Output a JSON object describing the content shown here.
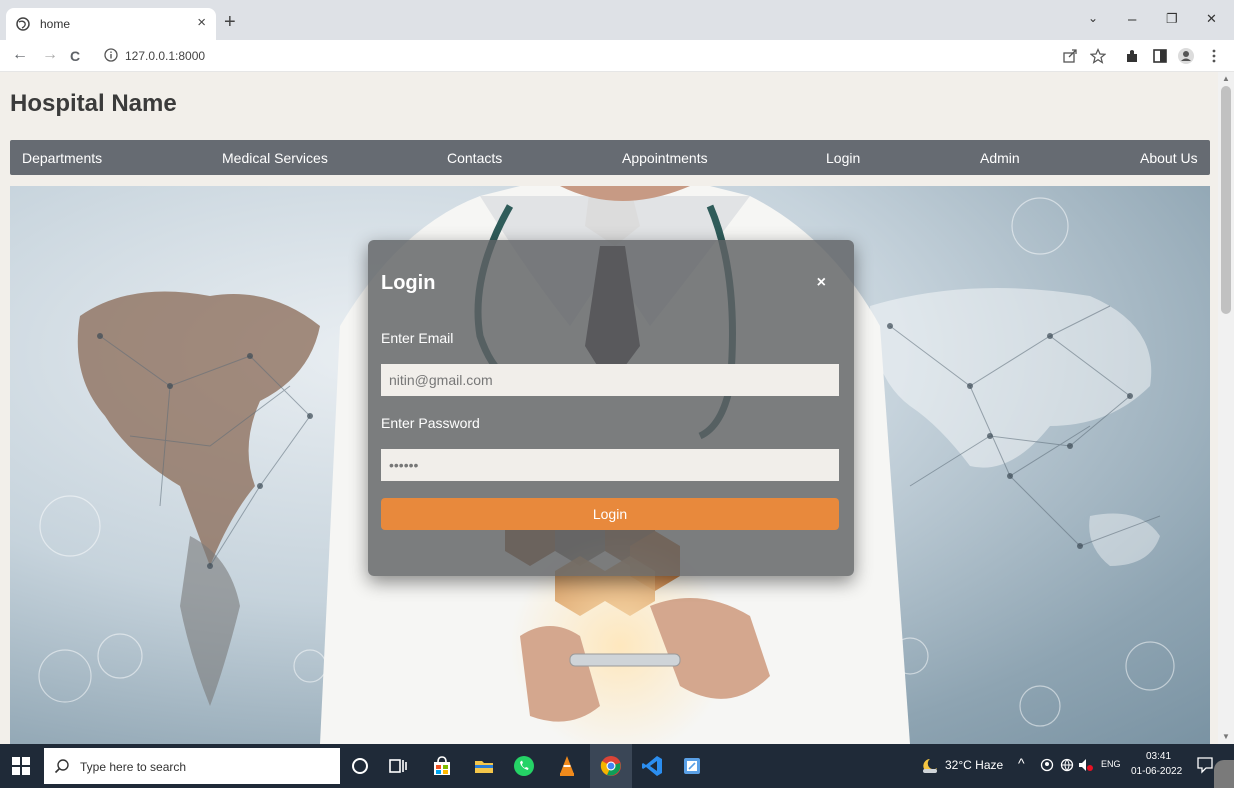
{
  "browser": {
    "tab_title": "home",
    "tab_close": "×",
    "new_tab": "+",
    "url": "127.0.0.1:8000",
    "window_controls": {
      "minimize": "–",
      "maximize": "❐",
      "close": "✕",
      "tab_search": "⌄"
    },
    "nav": {
      "back": "←",
      "forward": "→",
      "reload": "C"
    }
  },
  "site": {
    "title": "Hospital Name",
    "nav": [
      "Departments",
      "Medical Services",
      "Contacts",
      "Appointments",
      "Login",
      "Admin",
      "About Us"
    ]
  },
  "login_modal": {
    "title": "Login",
    "close": "×",
    "email_label": "Enter Email",
    "email_value": "nitin@gmail.com",
    "password_label": "Enter Password",
    "password_value": "••••••",
    "submit": "Login"
  },
  "taskbar": {
    "search_placeholder": "Type here to search",
    "weather": "32°C  Haze",
    "lang": "ENG",
    "time": "03:41",
    "date": "01-06-2022"
  },
  "colors": {
    "nav_bg": "#666b72",
    "page_bg": "#f2efea",
    "button": "#e8893c",
    "taskbar": "#1f2a38"
  }
}
